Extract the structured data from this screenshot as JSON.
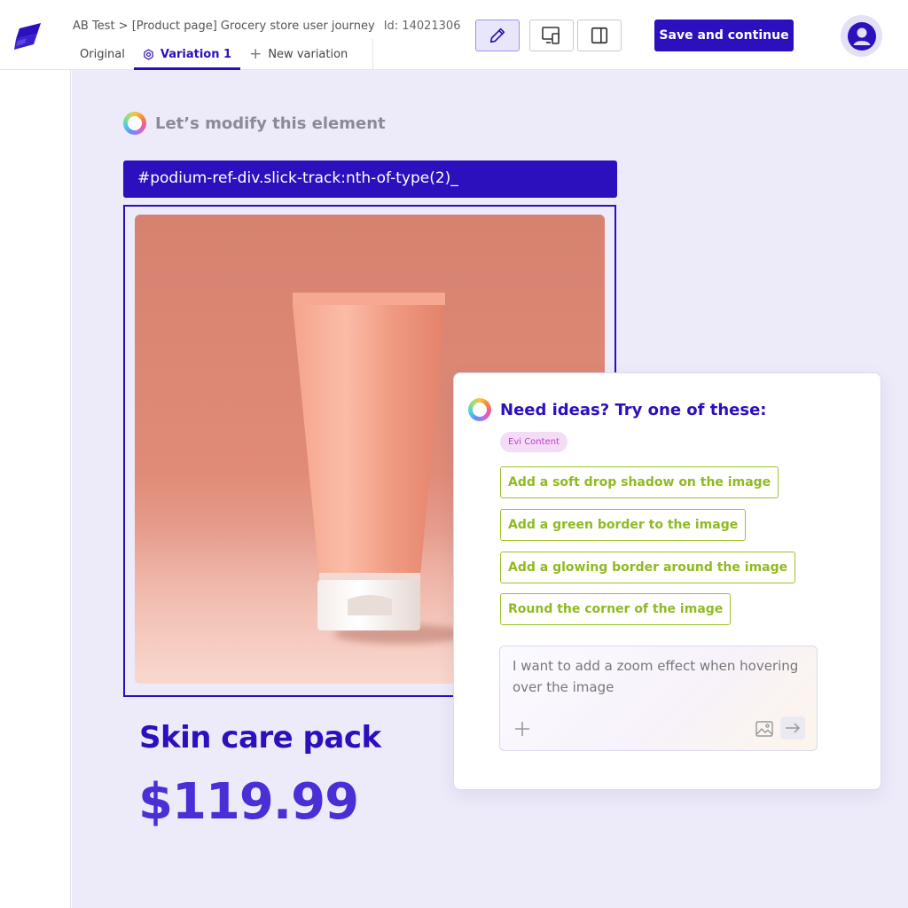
{
  "header": {
    "breadcrumb": "AB Test > [Product page] Grocery store user journey",
    "id_label": "Id: 14021306",
    "tabs": [
      {
        "label": "Original",
        "icon": ""
      },
      {
        "label": "Variation 1",
        "icon": "settings-icon"
      },
      {
        "label": "New variation",
        "icon": "plus-icon"
      }
    ],
    "tools": [
      "pencil-icon",
      "responsive-icon",
      "sidebar-panel-icon"
    ],
    "save_label": "Save and continue"
  },
  "editor": {
    "prompt_title": "Let’s modify this element",
    "selector": "#podium-ref-div.slick-track:nth-of-type(2)_"
  },
  "product": {
    "title": "Skin care pack",
    "price": "$119.99"
  },
  "ideas": {
    "heading": "Need ideas? Try one of these:",
    "badge": "Evi Content",
    "suggestions": [
      "Add a soft drop shadow on the image",
      "Add a green border to the image",
      "Add a glowing border around the image",
      "Round the corner of the image"
    ],
    "composer_value": "I want to add a zoom effect when hovering over the image"
  },
  "colors": {
    "brand": "#2c0fbd",
    "canvas": "#edeaf9",
    "suggestion": "#8fba21",
    "badge_text": "#c03cc9"
  }
}
